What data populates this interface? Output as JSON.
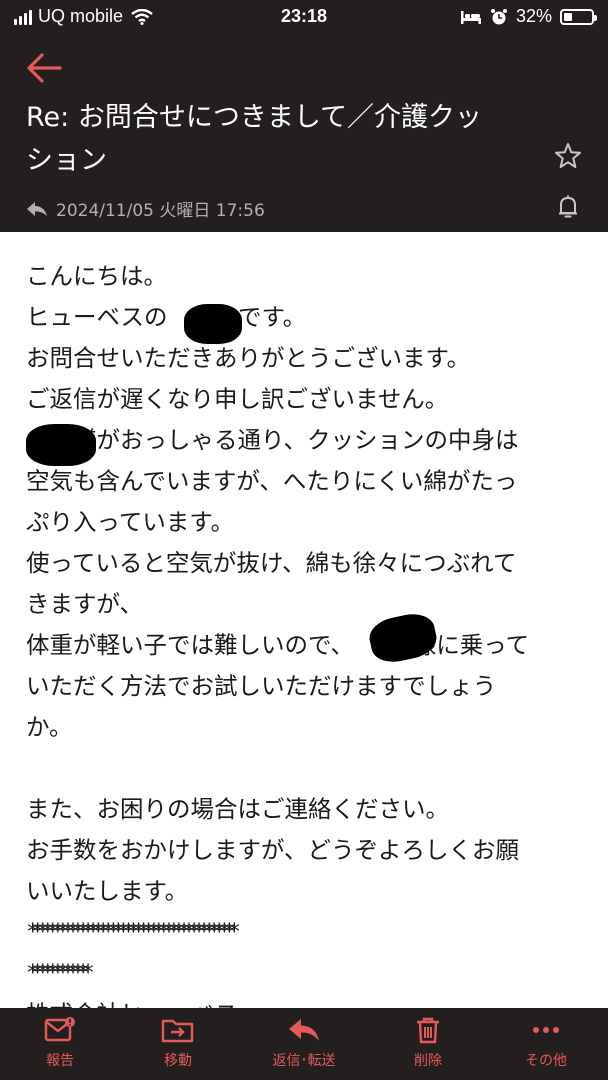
{
  "statusbar": {
    "carrier": "UQ mobile",
    "time": "23:18",
    "battery": "32%",
    "battery_level": 0.32
  },
  "header": {
    "subject_line1": "Re: お問合せにつきまして／介護クッ",
    "subject_line2": "ション",
    "date": "2024/11/05 火曜日 17:56"
  },
  "body_lines": {
    "l1": "こんにちは。",
    "l2": "ヒューベスの　　　です。",
    "l3": "お問合せいただきありがとうございます。",
    "l4": "ご返信が遅くなり申し訳ございません。",
    "l5": "　　様がおっしゃる通り、クッションの中身は",
    "l6": "空気も含んでいますが、へたりにくい綿がたっ",
    "l7": "ぷり入っています。",
    "l8": "使っていると空気が抜け、綿も徐々につぶれて",
    "l9": "きますが、",
    "l10": "体重が軽い子では難しいので、　　　様に乗って",
    "l11": "いただく方法でお試しいただけますでしょう",
    "l12": "か。",
    "l13": "また、お困りの場合はご連絡ください。",
    "l14": "お手数をおかけしますが、どうぞよろしくお願",
    "l15": "いいたします。",
    "l16": "*****************************************",
    "l17": "************",
    "l18": "株式会社ヒューベス"
  },
  "toolbar": {
    "report": "報告",
    "move": "移動",
    "reply": "返信･転送",
    "delete": "削除",
    "more": "その他"
  },
  "colors": {
    "accent": "#e25a5a",
    "header_bg": "#231f1f"
  }
}
